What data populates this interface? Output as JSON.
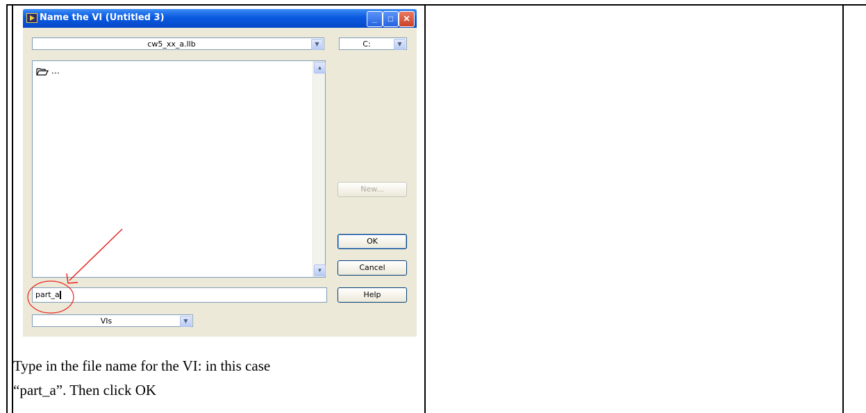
{
  "dialog": {
    "title": "Name the VI (Untitled 3)",
    "library_path": "cw5_xx_a.llb",
    "drive": "C:",
    "list_items": [
      "…"
    ],
    "filename_value": "part_a",
    "filetype": "VIs",
    "buttons": {
      "new": "New...",
      "ok": "OK",
      "cancel": "Cancel",
      "help": "Help"
    }
  },
  "caption": {
    "line1": "Type in the file name for the VI: in this case",
    "line2": "“part_a”. Then click OK"
  },
  "colors": {
    "titlebar": "#0a5ae0",
    "dialog_bg": "#ece9d8",
    "annotation": "#e8221e"
  }
}
